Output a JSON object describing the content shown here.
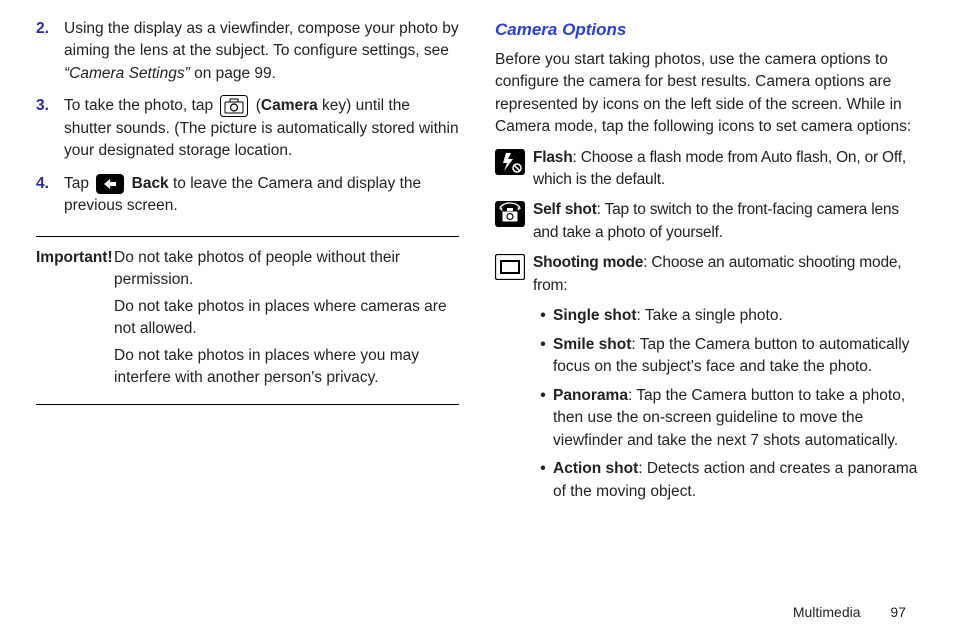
{
  "left": {
    "steps": {
      "s2": {
        "num": "2.",
        "text_a": "Using the display as a viewfinder, compose your photo by aiming the lens at the subject. To configure settings, see ",
        "ref": "“Camera Settings”",
        "text_b": " on page 99."
      },
      "s3": {
        "num": "3.",
        "text_a": "To take the photo, tap ",
        "camera_word": "Camera",
        "key_word": " key) until the shutter sounds. (The picture is automatically stored within your designated storage location."
      },
      "s4": {
        "num": "4.",
        "text_a": "Tap ",
        "back_word": "Back",
        "text_b": " to leave the Camera and display the previous screen."
      }
    },
    "important": {
      "lead": "Important!",
      "l1": "Do not take photos of people without their permission.",
      "l2": "Do not take photos in places where cameras are not allowed.",
      "l3": "Do not take photos in places where you may interfere with another person's privacy."
    }
  },
  "right": {
    "heading": "Camera Options",
    "intro": "Before you start taking photos, use the camera options to configure the camera for best results. Camera options are represented by icons on the left side of the screen. While in Camera mode, tap the following icons to set camera options:",
    "flash": {
      "label": "Flash",
      "text": ": Choose a flash mode from Auto flash, On, or Off, which is the default."
    },
    "selfshot": {
      "label": "Self shot",
      "text": ": Tap to switch to the front-facing camera lens and take a photo of yourself."
    },
    "shootingmode": {
      "label": "Shooting mode",
      "text": ": Choose an automatic shooting mode, from:"
    },
    "modes": {
      "single": {
        "label": "Single shot",
        "text": ": Take a single photo."
      },
      "smile": {
        "label": "Smile shot",
        "text": ": Tap the Camera button to automatically focus on the subject's face and take the photo."
      },
      "panorama": {
        "label": "Panorama",
        "text": ": Tap the Camera button to take a photo, then use the on-screen guideline to move the viewfinder and take the next 7 shots automatically."
      },
      "action": {
        "label": "Action shot",
        "text": ": Detects action and creates a panorama of the moving object."
      }
    }
  },
  "footer": {
    "section": "Multimedia",
    "page": "97"
  }
}
